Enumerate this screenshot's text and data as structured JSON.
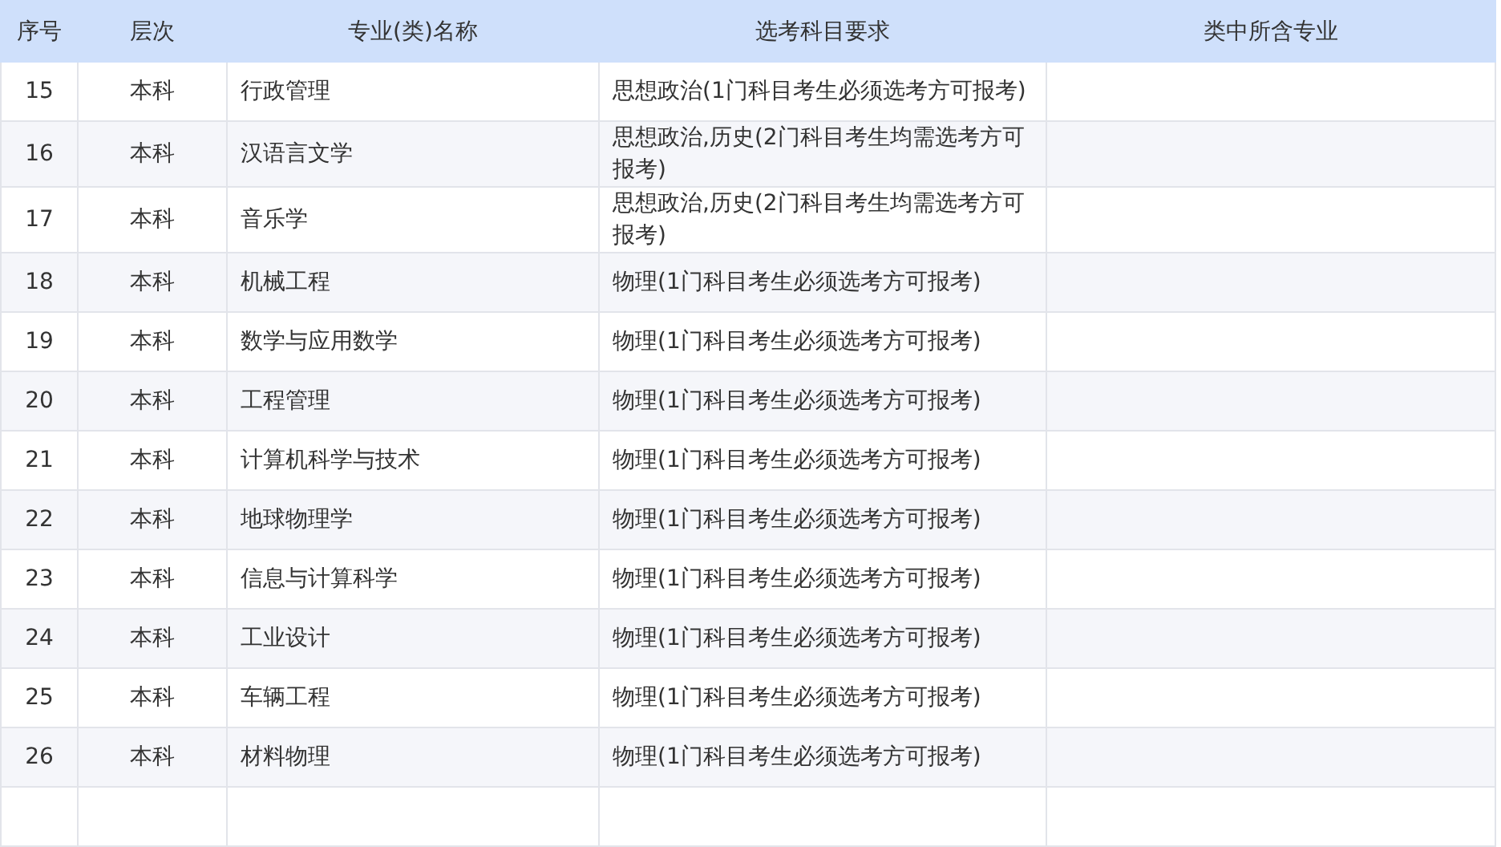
{
  "table": {
    "columns": [
      "序号",
      "层次",
      "专业(类)名称",
      "选考科目要求",
      "类中所含专业"
    ],
    "rows": [
      {
        "no": "15",
        "level": "本科",
        "major": "行政管理",
        "requirement": "思想政治(1门科目考生必须选考方可报考)"
      },
      {
        "no": "16",
        "level": "本科",
        "major": "汉语言文学",
        "requirement": "思想政治,历史(2门科目考生均需选考方可报考)"
      },
      {
        "no": "17",
        "level": "本科",
        "major": "音乐学",
        "requirement": "思想政治,历史(2门科目考生均需选考方可报考)"
      },
      {
        "no": "18",
        "level": "本科",
        "major": "机械工程",
        "requirement": "物理(1门科目考生必须选考方可报考)"
      },
      {
        "no": "19",
        "level": "本科",
        "major": "数学与应用数学",
        "requirement": "物理(1门科目考生必须选考方可报考)"
      },
      {
        "no": "20",
        "level": "本科",
        "major": "工程管理",
        "requirement": "物理(1门科目考生必须选考方可报考)"
      },
      {
        "no": "21",
        "level": "本科",
        "major": "计算机科学与技术",
        "requirement": "物理(1门科目考生必须选考方可报考)"
      },
      {
        "no": "22",
        "level": "本科",
        "major": "地球物理学",
        "requirement": "物理(1门科目考生必须选考方可报考)"
      },
      {
        "no": "23",
        "level": "本科",
        "major": "信息与计算科学",
        "requirement": "物理(1门科目考生必须选考方可报考)"
      },
      {
        "no": "24",
        "level": "本科",
        "major": "工业设计",
        "requirement": "物理(1门科目考生必须选考方可报考)"
      },
      {
        "no": "25",
        "level": "本科",
        "major": "车辆工程",
        "requirement": "物理(1门科目考生必须选考方可报考)"
      },
      {
        "no": "26",
        "level": "本科",
        "major": "材料物理",
        "requirement": "物理(1门科目考生必须选考方可报考)"
      }
    ]
  }
}
